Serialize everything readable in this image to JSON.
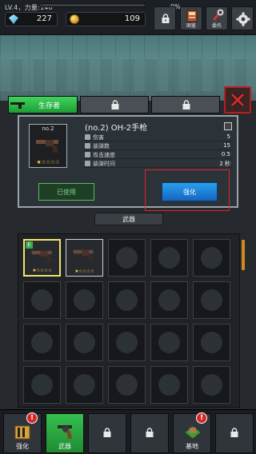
{
  "topbar": {
    "level_text": "LV.4，力量:140",
    "progress_label": "0%",
    "progress_fraction": 0.0,
    "gems": "227",
    "coins": "109",
    "book_label": "图鉴",
    "entrust_label": "委托"
  },
  "tabs": {
    "survivor_label": "生存者"
  },
  "weapon": {
    "number": "no.2",
    "title": "(no.2) OH-2手枪",
    "rating": "★☆☆☆☆",
    "stats": [
      {
        "name": "伤害",
        "value": "5"
      },
      {
        "name": "装弹数",
        "value": "15"
      },
      {
        "name": "攻击速度",
        "value": "0.5"
      },
      {
        "name": "装弹时间",
        "value": "2 秒"
      }
    ],
    "used_label": "已使用",
    "enhance_label": "强化"
  },
  "category": "武器",
  "inventory": {
    "slot_rating": "★☆☆☆☆",
    "equipped_tag": "E"
  },
  "bottomnav": {
    "enhance_label": "强化",
    "weapon_label": "武器",
    "base_label": "基地",
    "alert_mark": "!"
  },
  "colors": {
    "accent_green": "#1d9d35",
    "enhance_blue": "#1666bd",
    "highlight_red": "#e0222a",
    "selected_yellow": "#f3e36c"
  },
  "icons": [
    "gem-icon",
    "coin-icon",
    "lock-icon",
    "book-icon",
    "wrench-icon",
    "gear-icon",
    "pistol-icon",
    "close-icon",
    "info-icon",
    "crate-icon",
    "revolver-icon",
    "base-icon"
  ]
}
